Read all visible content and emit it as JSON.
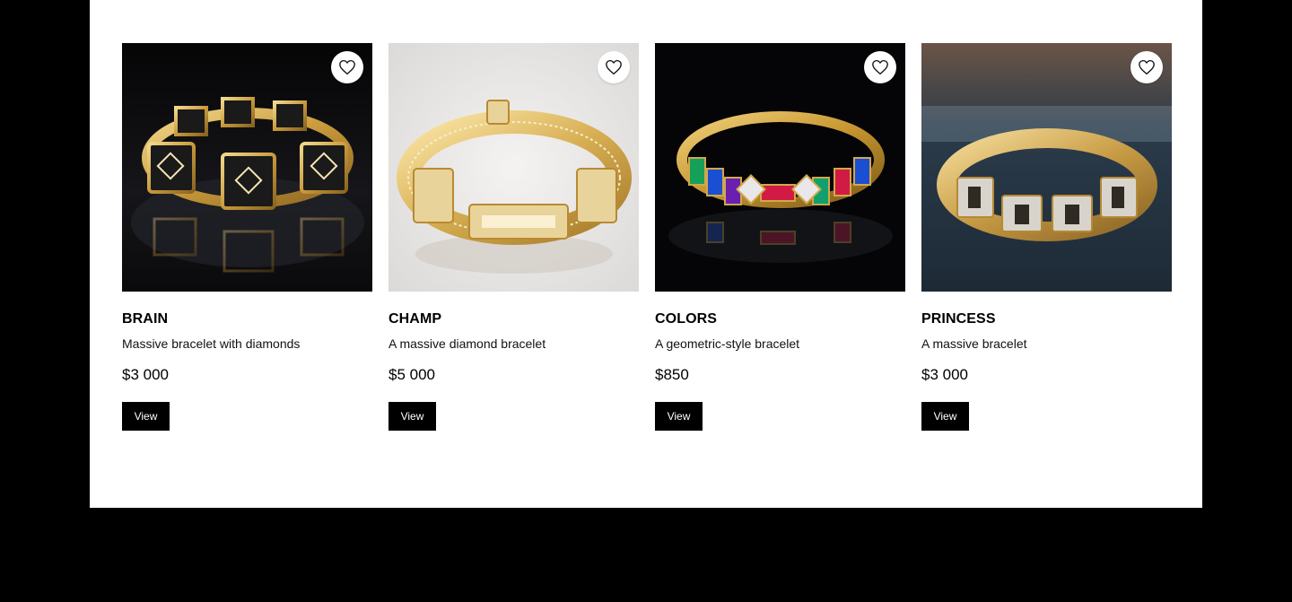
{
  "products": [
    {
      "name": "BRAIN",
      "description": "Massive bracelet with diamonds",
      "price": "$3 000",
      "cta": "View",
      "image": "black-gold-square-link-bracelet",
      "background": "#0b0b0c"
    },
    {
      "name": "CHAMP",
      "description": "A massive diamond bracelet",
      "price": "$5 000",
      "cta": "View",
      "image": "gold-diamond-pave-bracelet",
      "background": "#e9e7e5"
    },
    {
      "name": "COLORS",
      "description": "A geometric-style bracelet",
      "price": "$850",
      "cta": "View",
      "image": "gold-multicolor-gem-bracelet",
      "background": "#050507"
    },
    {
      "name": "PRINCESS",
      "description": "A massive bracelet",
      "price": "$3 000",
      "cta": "View",
      "image": "gold-pave-link-bracelet",
      "background": "#2a3a48"
    }
  ],
  "icons": {
    "favorite": "heart-outline-icon"
  },
  "colors": {
    "page_background": "#000000",
    "panel_background": "#ffffff",
    "button_background": "#000000",
    "button_text": "#ffffff",
    "gold": "#d9b25a"
  }
}
